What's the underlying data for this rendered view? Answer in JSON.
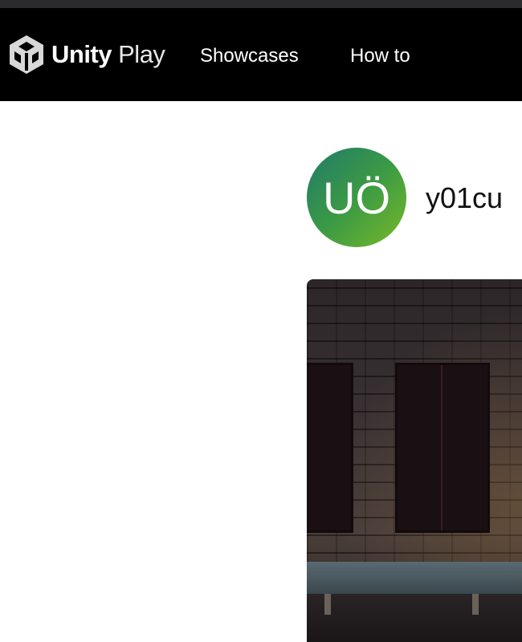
{
  "header": {
    "logo_icon": "unity-cube-icon",
    "brand_bold": "Unity",
    "brand_light": "Play",
    "nav": [
      {
        "label": "Showcases"
      },
      {
        "label": "How to"
      }
    ]
  },
  "profile": {
    "avatar_initials": "UÖ",
    "username": "y01cu"
  },
  "game": {
    "thumbnail": "game-thumbnail"
  }
}
